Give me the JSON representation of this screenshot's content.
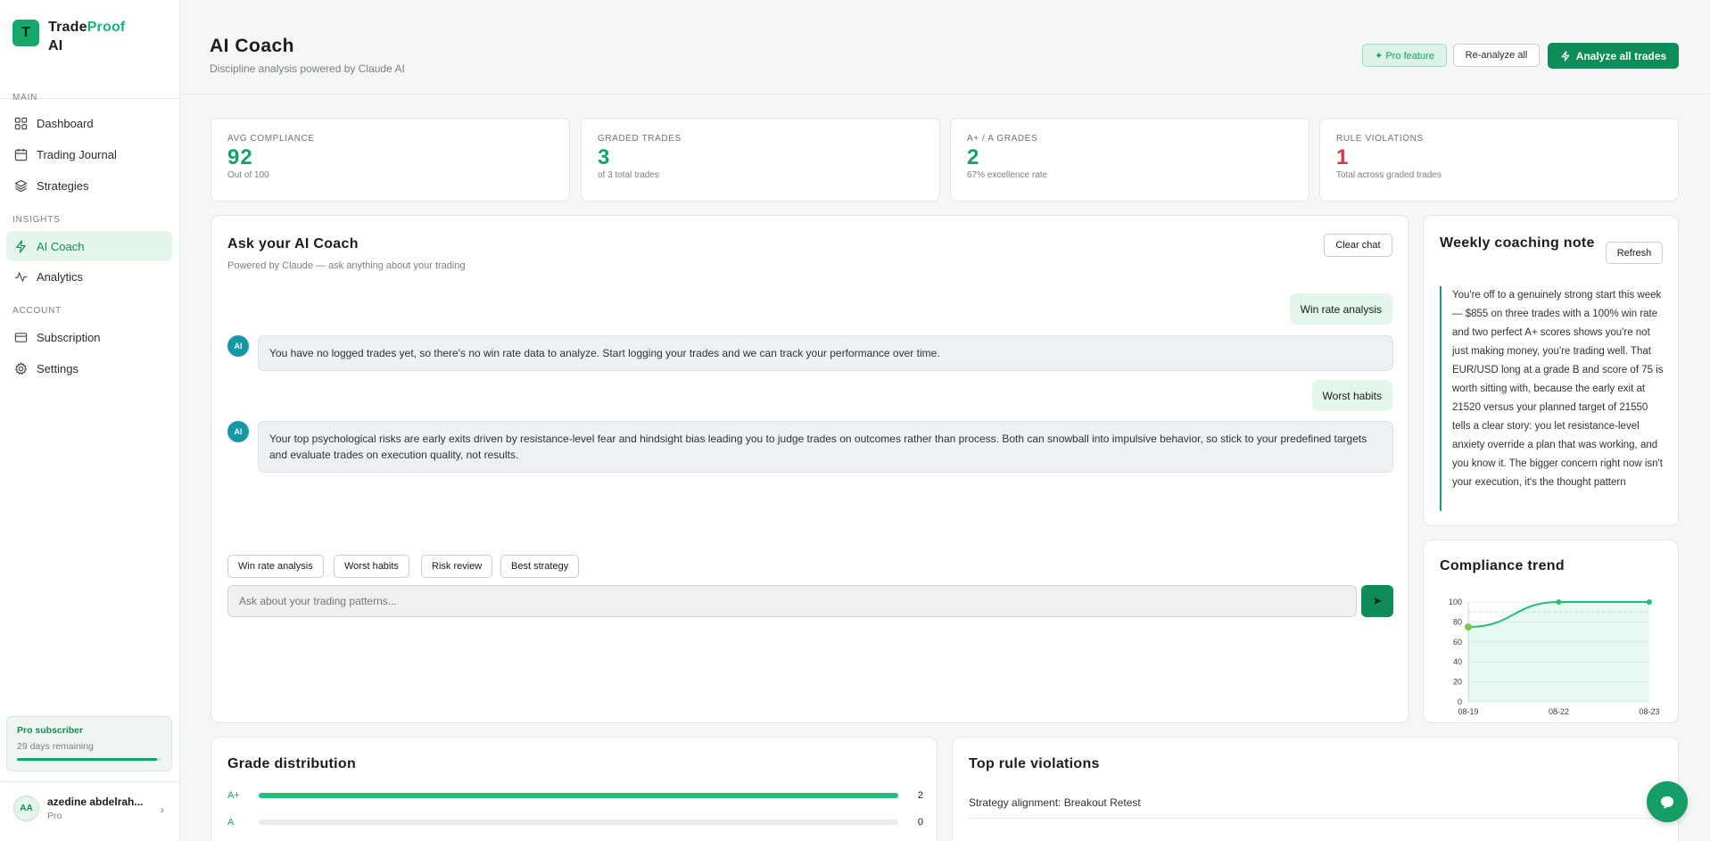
{
  "brand": {
    "name_part1": "Trade",
    "name_part2": "Proof",
    "name_part3": "AI",
    "logo_letter": "T"
  },
  "sidebar": {
    "sections": [
      "MAIN",
      "INSIGHTS",
      "ACCOUNT"
    ],
    "items": [
      {
        "label": "Dashboard",
        "icon": "grid-icon"
      },
      {
        "label": "Trading Journal",
        "icon": "calendar-icon"
      },
      {
        "label": "Strategies",
        "icon": "layers-icon"
      },
      {
        "label": "AI Coach",
        "icon": "bolt-icon",
        "active": true
      },
      {
        "label": "Analytics",
        "icon": "activity-icon"
      },
      {
        "label": "Subscription",
        "icon": "card-icon"
      },
      {
        "label": "Settings",
        "icon": "gear-icon"
      }
    ],
    "pro": {
      "title": "Pro subscriber",
      "subtitle": "29 days remaining",
      "progress": 0.97
    },
    "user": {
      "initials": "AA",
      "name": "azedine abdelrah...",
      "plan": "Pro"
    }
  },
  "header": {
    "title": "AI Coach",
    "subtitle": "Discipline analysis powered by Claude AI",
    "pro_badge": "✦ Pro feature",
    "reanalyze": "Re-analyze all",
    "analyze": "Analyze all trades"
  },
  "stats": [
    {
      "label": "AVG COMPLIANCE",
      "value": "92",
      "note": "Out of 100"
    },
    {
      "label": "GRADED TRADES",
      "value": "3",
      "note": "of 3 total trades"
    },
    {
      "label": "A+ / A GRADES",
      "value": "2",
      "note": "67% excellence rate"
    },
    {
      "label": "RULE VIOLATIONS",
      "value": "1",
      "note": "Total across graded trades"
    }
  ],
  "chat": {
    "title": "Ask your AI Coach",
    "subtitle": "Powered by Claude — ask anything about your trading",
    "clear": "Clear chat",
    "ai_label": "AI",
    "messages": [
      {
        "role": "user",
        "text": "Win rate analysis"
      },
      {
        "role": "ai",
        "text": "You have no logged trades yet, so there's no win rate data to analyze. Start logging your trades and we can track your performance over time."
      },
      {
        "role": "user",
        "text": "Worst habits"
      },
      {
        "role": "ai",
        "text": "Your top psychological risks are early exits driven by resistance-level fear and hindsight bias leading you to judge trades on outcomes rather than process. Both can snowball into impulsive behavior, so stick to your predefined targets and evaluate trades on execution quality, not results."
      }
    ],
    "chips": [
      "Win rate analysis",
      "Worst habits",
      "Risk review",
      "Best strategy"
    ],
    "placeholder": "Ask about your trading patterns..."
  },
  "weekly": {
    "title": "Weekly coaching note",
    "refresh": "Refresh",
    "text": "You're off to a genuinely strong start this week — $855 on three trades with a 100% win rate and two perfect A+ scores shows you're not just making money, you're trading well. That EUR/USD long at a grade B and score of 75 is worth sitting with, because the early exit at 21520 versus your planned target of 21550 tells a clear story: you let resistance-level anxiety override a plan that was working, and you know it. The bigger concern right now isn't your execution, it's the thought pattern"
  },
  "trend": {
    "title": "Compliance trend",
    "chart_data": {
      "type": "area",
      "x": [
        "08-19",
        "08-22",
        "08-23"
      ],
      "values": [
        75,
        100,
        100
      ],
      "ylim": [
        0,
        100
      ],
      "yticks": [
        0,
        20,
        40,
        60,
        80,
        100
      ],
      "color": "#22c07a"
    }
  },
  "grades": {
    "title": "Grade distribution",
    "rows": [
      {
        "label": "A+",
        "count": "2",
        "fraction": 1.0
      },
      {
        "label": "A",
        "count": "0",
        "fraction": 0.0
      }
    ]
  },
  "violations": {
    "title": "Top rule violations",
    "items": [
      "Strategy alignment: Breakout Retest"
    ]
  },
  "colors": {
    "accent": "#17a06a",
    "accent_dark": "#0e8d58",
    "danger": "#d6374d"
  }
}
